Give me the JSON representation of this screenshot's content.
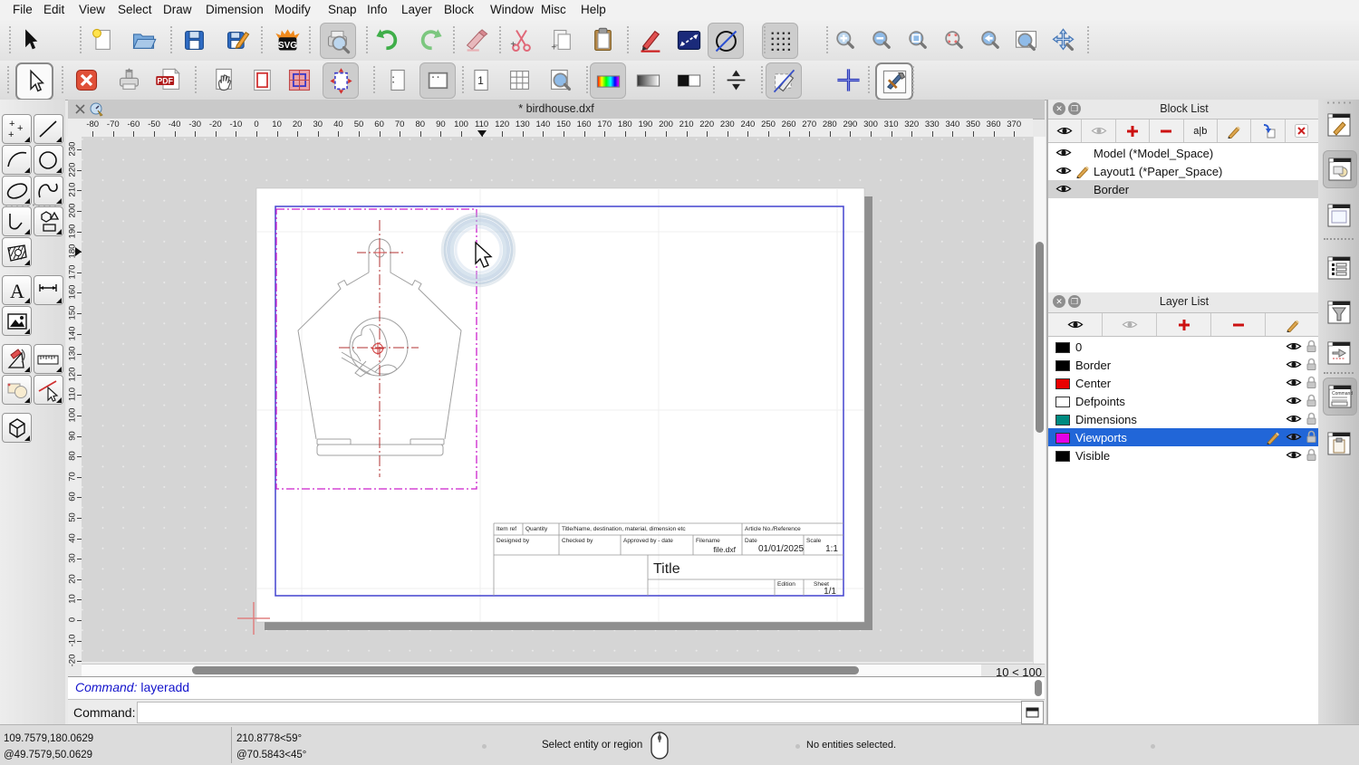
{
  "window": {
    "title": "* birdhouse.dxf"
  },
  "menu": {
    "items": [
      "File",
      "Edit",
      "View",
      "Select",
      "Draw",
      "Dimension",
      "Modify",
      "Snap",
      "Info",
      "Layer",
      "Block",
      "Window",
      "Misc",
      "Help"
    ]
  },
  "toolbar1": {
    "items": [
      "select-pointer",
      "new-document",
      "open-file",
      "save",
      "save-as",
      "export-svg",
      "print-preview",
      "undo",
      "redo",
      "erase",
      "cut",
      "copy",
      "paste",
      "pen-red",
      "distance",
      "circle-slash",
      "grid-dots",
      "zoom-in",
      "zoom-out",
      "zoom-auto",
      "zoom-select",
      "zoom-previous",
      "zoom-window",
      "zoom-pan"
    ]
  },
  "toolbar2": {
    "items": [
      "select-pointer-2",
      "close-red",
      "print-upload",
      "export-pdf",
      "hand-page",
      "page-red-border",
      "viewport-grid",
      "viewport-dashed",
      "page-plain",
      "page-active",
      "page-one",
      "grid-nine",
      "zoom-page",
      "color-bar",
      "gray-gradient",
      "blackwhite",
      "compress",
      "draft-mode",
      "crosshair-plus",
      "tools"
    ]
  },
  "left_toolbar": {
    "items": [
      "points",
      "line",
      "arc",
      "circle",
      "ellipse",
      "spline",
      "polyline",
      "polygon",
      "hatch",
      "text",
      "dimension",
      "image",
      "measure",
      "ruler",
      "block",
      "modify-delete",
      "box3d"
    ]
  },
  "hruler": {
    "start": -80,
    "end": 370,
    "step": 10,
    "marker": 110
  },
  "vruler": {
    "start": -20,
    "end": 230,
    "step": 10,
    "marker": 180
  },
  "canvas": {
    "zoom_range": "10 < 100"
  },
  "title_block": {
    "item_ref": "Item ref",
    "quantity": "Quantity",
    "title_name": "Title/Name, destination, material, dimension etc",
    "article": "Article No./Reference",
    "designed_by": "Designed by",
    "checked_by": "Checked by",
    "approved_by": "Approved by - date",
    "filename_label": "Filename",
    "filename": "file.dxf",
    "date_label": "Date",
    "date": "01/01/2025",
    "scale_label": "Scale",
    "scale": "1:1",
    "title": "Title",
    "edition_label": "Edition",
    "sheet_label": "Sheet",
    "sheet": "1/1"
  },
  "block_list": {
    "title": "Block List",
    "toolbar": [
      "show-all",
      "hide-all",
      "add-block",
      "remove-block",
      "rename-block",
      "edit-block",
      "insert-block",
      "delete-block"
    ],
    "items": [
      {
        "name": "Model (*Model_Space)",
        "editing": false,
        "selected": false
      },
      {
        "name": "Layout1 (*Paper_Space)",
        "editing": true,
        "selected": false
      },
      {
        "name": "Border",
        "editing": false,
        "selected": true
      }
    ]
  },
  "layer_list": {
    "title": "Layer List",
    "toolbar": [
      "show-all",
      "hide-all",
      "add-layer",
      "remove-layer",
      "edit-layer"
    ],
    "layers": [
      {
        "name": "0",
        "color": "#000000",
        "selected": false,
        "editing": false
      },
      {
        "name": "Border",
        "color": "#000000",
        "selected": false,
        "editing": false
      },
      {
        "name": "Center",
        "color": "#e80000",
        "selected": false,
        "editing": false
      },
      {
        "name": "Defpoints",
        "color": "#ffffff",
        "selected": false,
        "editing": false
      },
      {
        "name": "Dimensions",
        "color": "#008a80",
        "selected": false,
        "editing": false
      },
      {
        "name": "Viewports",
        "color": "#e500e5",
        "selected": true,
        "editing": true
      },
      {
        "name": "Visible",
        "color": "#000000",
        "selected": false,
        "editing": false
      }
    ],
    "selection_color": "#2166d8"
  },
  "command": {
    "history_label": "Command:",
    "history_value": "layeradd",
    "prompt_label": "Command:"
  },
  "status": {
    "coord_abs": "109.7579,180.0629",
    "coord_rel": "@49.7579,50.0629",
    "polar_abs": "210.8778<59°",
    "polar_rel": "@70.5843<45°",
    "hint": "Select entity or region",
    "selection": "No entities selected."
  }
}
